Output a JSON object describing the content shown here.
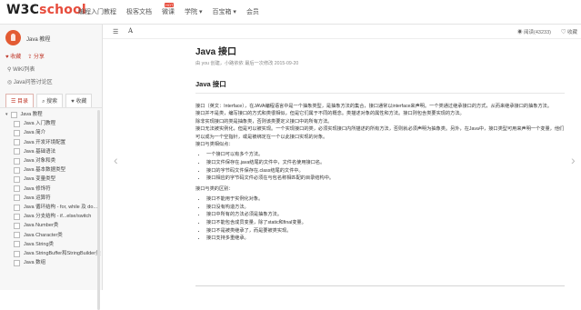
{
  "header": {
    "logo_prefix": "W3C",
    "logo_suffix": "school",
    "nav": [
      "编程入门教程",
      "极客文档",
      "微课",
      "学院 ▾",
      "百宝箱 ▾",
      "会员"
    ],
    "hot_badge": "HOT"
  },
  "sidebar": {
    "book_title": "Java 教程",
    "actions": [
      "♥ 收藏",
      "⇪ 分享"
    ],
    "wiki_link": "WiKi列表",
    "qa_link": "Java问答讨论区",
    "tabs": [
      "目录",
      "搜索",
      "收藏"
    ],
    "tree": [
      {
        "label": "Java 教程",
        "type": "root"
      },
      {
        "label": "Java 入门教程",
        "type": "child"
      },
      {
        "label": "Java 简介",
        "type": "child"
      },
      {
        "label": "Java 开发环境配置",
        "type": "child"
      },
      {
        "label": "Java 基础语法",
        "type": "child"
      },
      {
        "label": "Java 对象和类",
        "type": "child"
      },
      {
        "label": "Java 基本数据类型",
        "type": "child"
      },
      {
        "label": "Java 变量类型",
        "type": "child"
      },
      {
        "label": "Java 修饰符",
        "type": "child"
      },
      {
        "label": "Java 运算符",
        "type": "child"
      },
      {
        "label": "Java 循环结构 - for, while 及 do...",
        "type": "child"
      },
      {
        "label": "Java 分支结构 - if...else/switch",
        "type": "child"
      },
      {
        "label": "Java Number类",
        "type": "child"
      },
      {
        "label": "Java Character类",
        "type": "child"
      },
      {
        "label": "Java String类",
        "type": "child"
      },
      {
        "label": "Java StringBuffer和StringBuilder类",
        "type": "child"
      },
      {
        "label": "Java 数组",
        "type": "child"
      }
    ]
  },
  "toolbar": {
    "menu_glyph": "☰",
    "font_glyph": "A",
    "read_count": "◉ 阅读(43233)",
    "collect": "♡ 收藏"
  },
  "article": {
    "title": "Java 接口",
    "meta": "由 you 创建，小路依依 最后一次修改 2015-09-20",
    "section_title": "Java 接口",
    "paragraphs": [
      "接口（英文：Interface），在JAVA编程语言中是一个抽象类型，是抽象方法的集合，接口通常以interface来声明。一个类通过继承接口的方式，从而来继承接口的抽象方法。",
      "接口并不是类，编写接口的方式和类很相似，但是它们属于不同的概念。类描述对象的属性和方法。接口则包含类要实现的方法。",
      "除非实现接口的类是抽象类，否则该类要定义接口中的所有方法。",
      "接口无法被实例化，但是可以被实现。一个实现接口的类，必须实现接口内所描述的所有方法，否则就必须声明为抽象类。另外，在Java中，接口类型可用来声明一个变量，他们可以成为一个空指针，或是被绑定在一个以此接口实现的对象。",
      "接口与类相似点："
    ],
    "similar": [
      "一个接口可以有多个方法。",
      "接口文件保存在.java结尾的文件中，文件名使用接口名。",
      "接口的字节码文件保存在.class结尾的文件中。",
      "接口相应的字节码文件必须在与包名称相匹配的目录结构中。"
    ],
    "diff_title": "接口与类的区别：",
    "diff": [
      "接口不能用于实例化对象。",
      "接口没有构造方法。",
      "接口中所有的方法必须是抽象方法。",
      "接口不能包含成员变量，除了static和final变量。",
      "接口不是被类继承了，而是要被类实现。",
      "接口支持多重继承。"
    ]
  },
  "nav_arrows": {
    "prev": "‹",
    "next": "›"
  }
}
